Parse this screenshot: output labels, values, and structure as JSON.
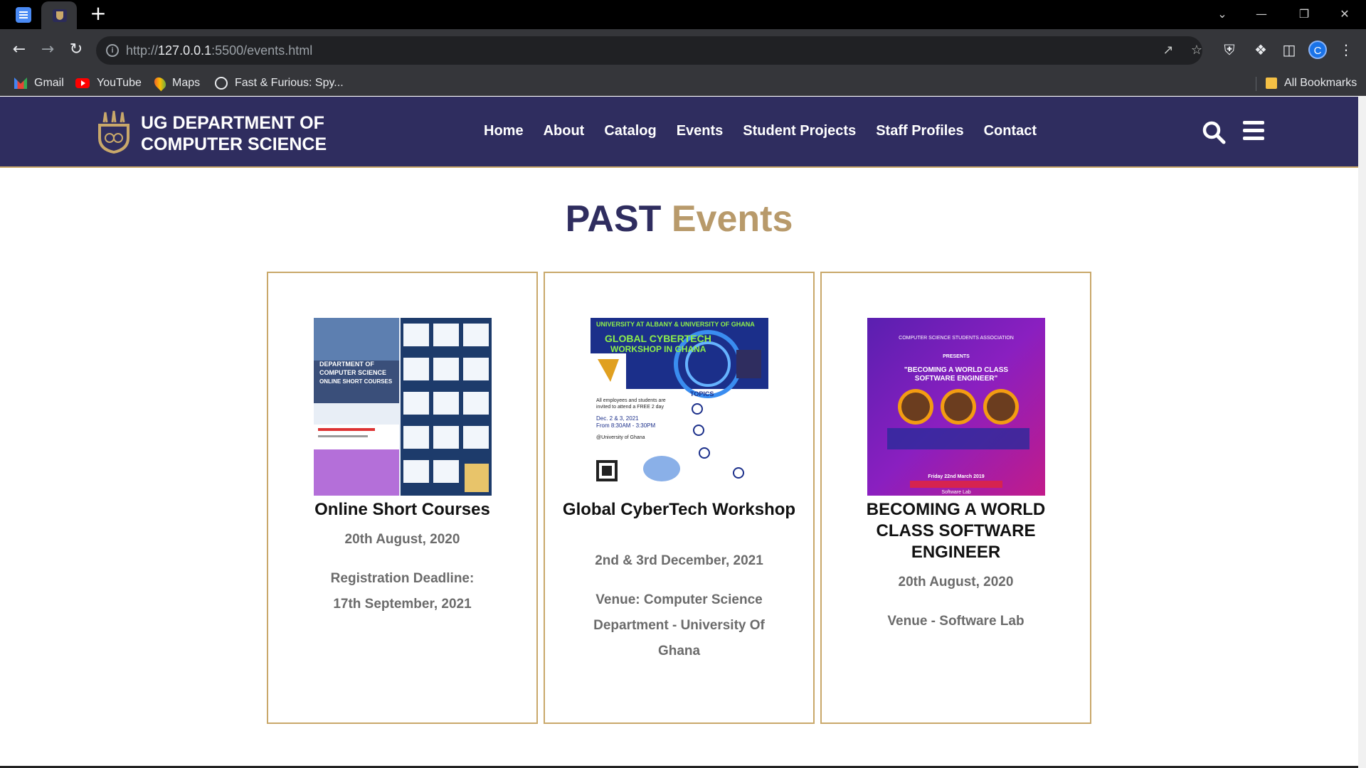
{
  "browser": {
    "url_scheme": "http://",
    "url_host": "127.0.0.1",
    "url_path": ":5500/events.html",
    "bookmarks": [
      "Gmail",
      "YouTube",
      "Maps",
      "Fast & Furious: Spy..."
    ],
    "all_bookmarks": "All Bookmarks",
    "profile_initial": "C"
  },
  "site": {
    "title_line1": "UG DEPARTMENT OF",
    "title_line2": "COMPUTER SCIENCE",
    "nav": [
      "Home",
      "About",
      "Catalog",
      "Events",
      "Student Projects",
      "Staff Profiles",
      "Contact"
    ]
  },
  "page": {
    "heading_word1": "PAST",
    "heading_word2": "Events"
  },
  "events": [
    {
      "title": "Online Short Courses",
      "date": "20th August, 2020",
      "info_line1": "Registration Deadline:",
      "info_line2": "17th September, 2021",
      "poster_text": "DEPARTMENT OF COMPUTER SCIENCE ONLINE SHORT COURSES"
    },
    {
      "title": "Global CyberTech Workshop",
      "date": "2nd & 3rd December, 2021",
      "info_line1": "Venue: Computer Science",
      "info_line2": "Department - University Of",
      "info_line3": "Ghana",
      "poster_text": "GLOBAL CYBERTECH WORKSHOP IN GHANA"
    },
    {
      "title": "BECOMING A WORLD CLASS SOFTWARE ENGINEER",
      "date": "20th August, 2020",
      "info_line1": "Venue - Software Lab",
      "poster_text": "\"BECOMING A WORLD CLASS SOFTWARE ENGINEER\""
    }
  ],
  "colors": {
    "brand_navy": "#2f2d5f",
    "brand_gold": "#b89a6b",
    "card_border": "#c9a86a"
  }
}
